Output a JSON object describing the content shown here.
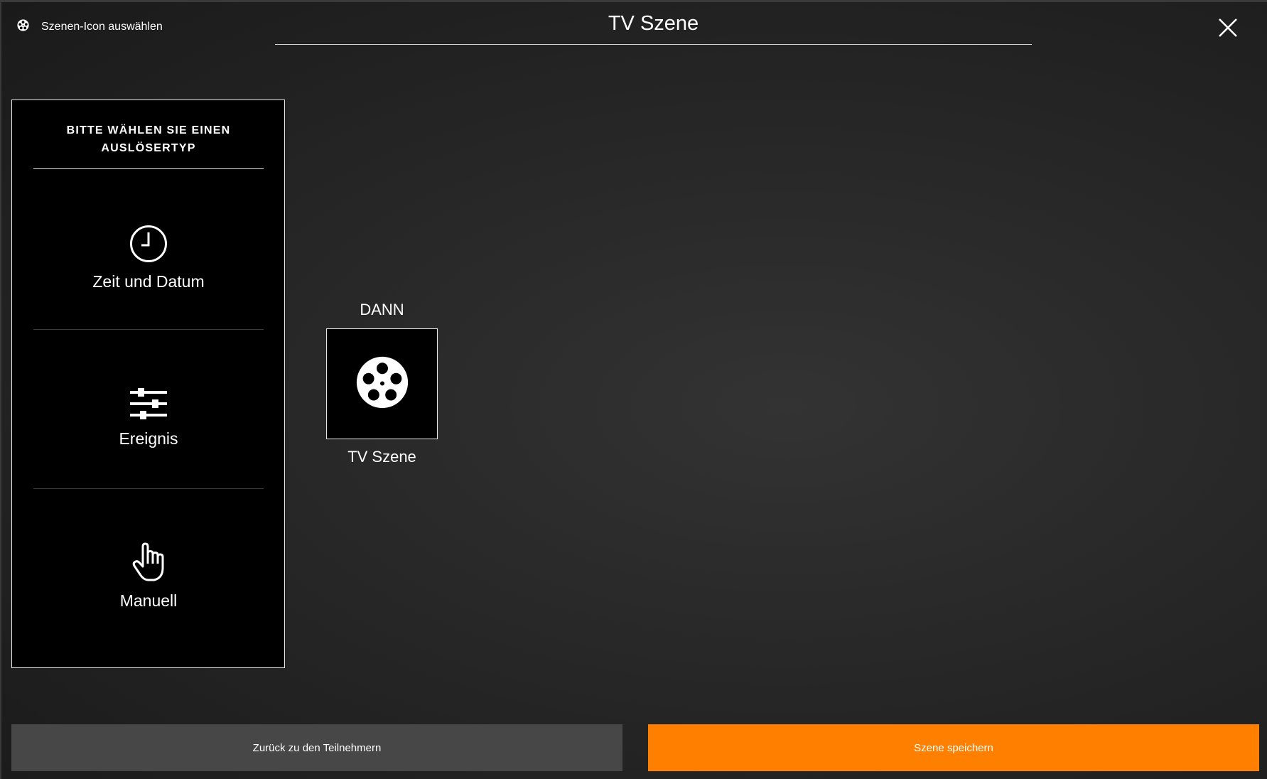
{
  "header": {
    "icon_select_label": "Szenen-Icon auswählen",
    "title": "TV Szene"
  },
  "trigger_panel": {
    "heading_line1": "BITTE WÄHLEN SIE EINEN",
    "heading_line2": "AUSLÖSERTYP",
    "options": [
      {
        "label": "Zeit und Datum",
        "icon": "clock-icon"
      },
      {
        "label": "Ereignis",
        "icon": "sliders-icon"
      },
      {
        "label": "Manuell",
        "icon": "hand-pointer-icon"
      }
    ]
  },
  "action": {
    "label": "DANN",
    "scene_name": "TV Szene",
    "scene_icon": "film-reel-icon"
  },
  "footer": {
    "back_label": "Zurück zu den Teilnehmern",
    "save_label": "Szene speichern"
  },
  "colors": {
    "accent": "#ff8000",
    "secondary_button": "#474747",
    "panel_background": "#000000"
  }
}
